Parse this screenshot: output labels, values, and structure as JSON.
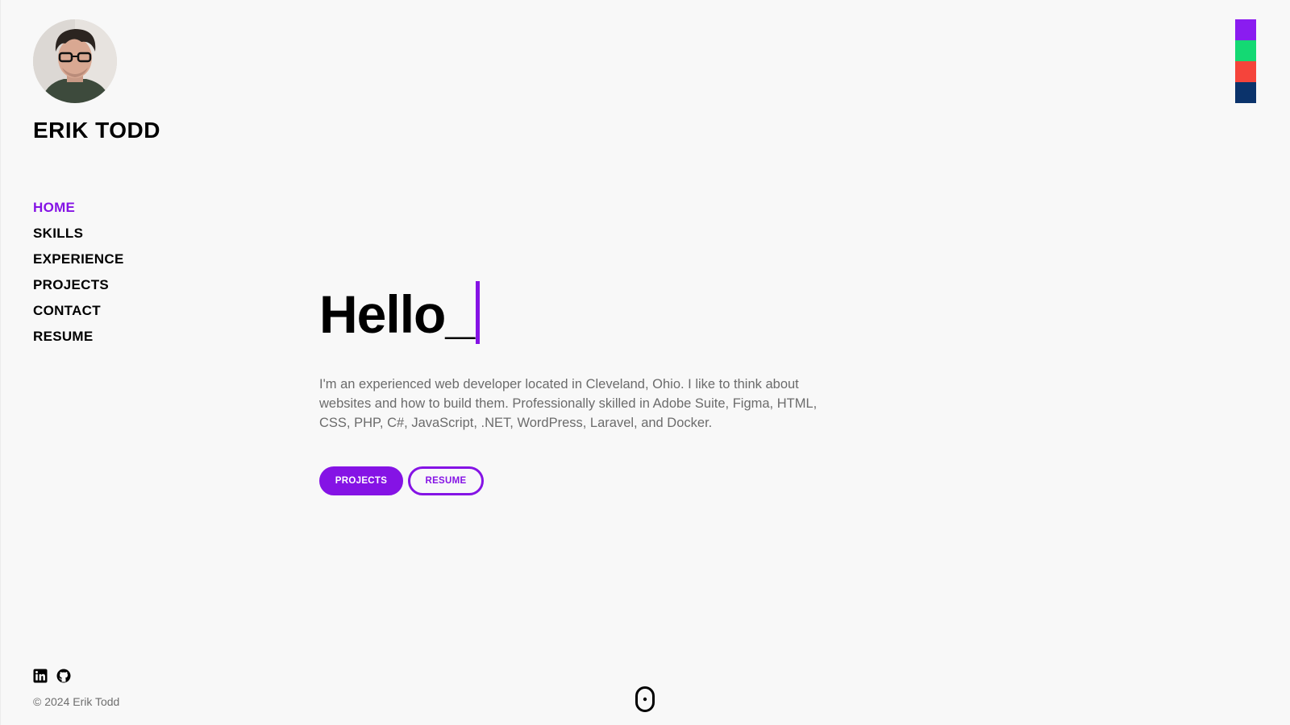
{
  "sidebar": {
    "name": "ERIK TODD",
    "avatar_icon": "profile-photo",
    "nav": [
      {
        "label": "HOME",
        "active": true
      },
      {
        "label": "SKILLS",
        "active": false
      },
      {
        "label": "EXPERIENCE",
        "active": false
      },
      {
        "label": "PROJECTS",
        "active": false
      },
      {
        "label": "CONTACT",
        "active": false
      },
      {
        "label": "RESUME",
        "active": false
      }
    ],
    "social": [
      {
        "icon": "linkedin-icon"
      },
      {
        "icon": "github-icon"
      }
    ],
    "copyright": "© 2024 Erik Todd"
  },
  "theme_swatches": [
    "#8a1cf0",
    "#14d973",
    "#f5443b",
    "#0b336b"
  ],
  "hero": {
    "greeting": "Hello_",
    "intro": "I'm an experienced web developer located in Cleveland, Ohio. I like to think about websites and how to build them. Professionally skilled in Adobe Suite, Figma, HTML, CSS, PHP, C#, JavaScript, .NET, WordPress, Laravel, and Docker.",
    "buttons": {
      "primary": "PROJECTS",
      "secondary": "RESUME"
    }
  },
  "colors": {
    "accent": "#8513e5",
    "text": "#000000",
    "muted": "#6b6b6b",
    "background": "#f8f8f8"
  },
  "scroll_icon": "mouse-scroll-icon"
}
